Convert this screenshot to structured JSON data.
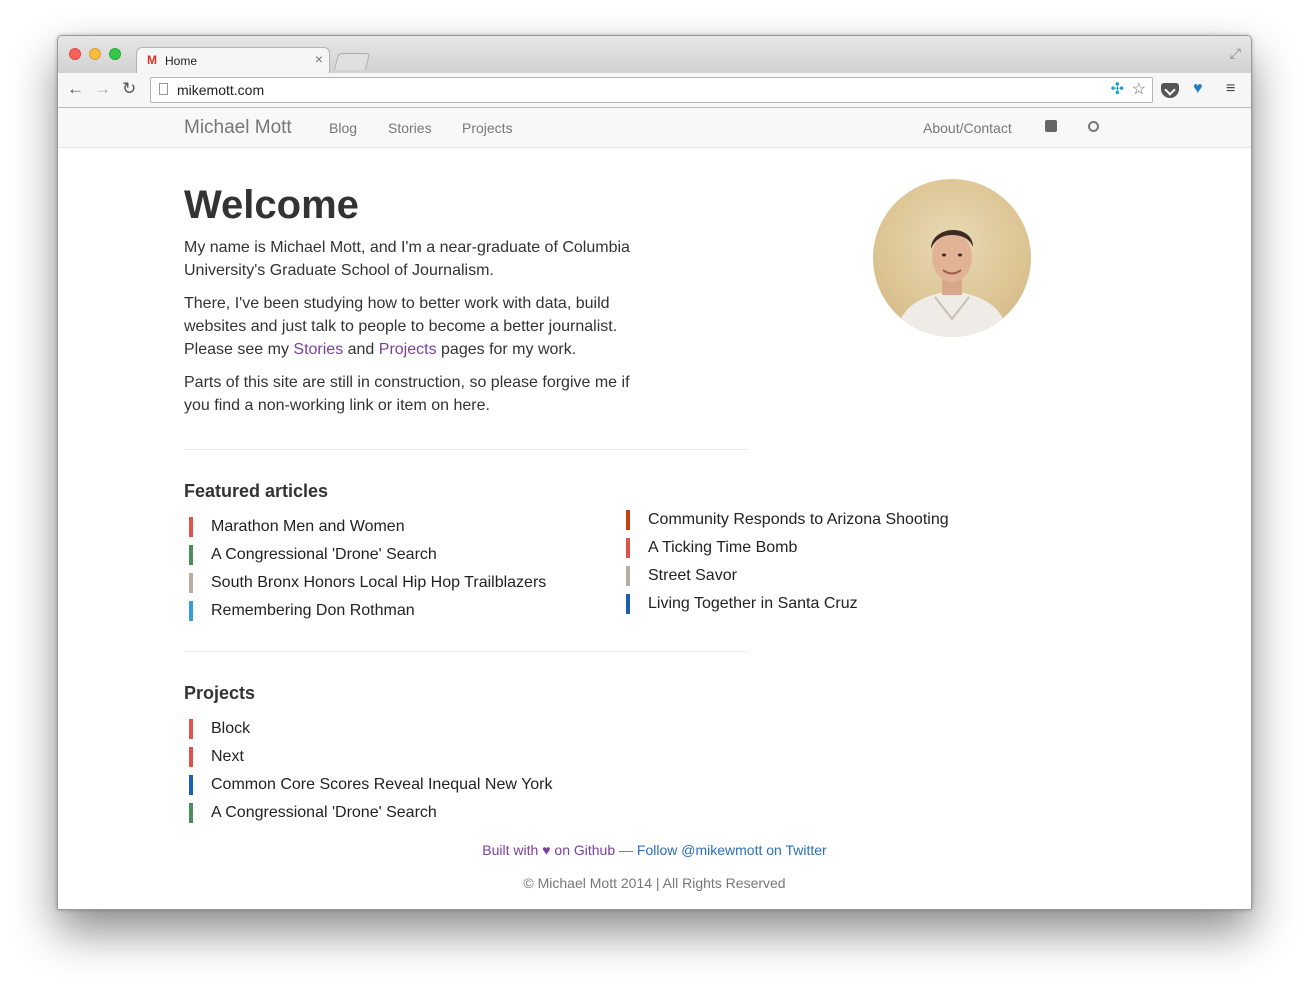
{
  "browser": {
    "tab_title": "Home",
    "tab_favicon": "gmail-icon",
    "url": "mikemott.com"
  },
  "site": {
    "brand": "Michael Mott",
    "nav": {
      "blog": "Blog",
      "stories": "Stories",
      "projects": "Projects",
      "about": "About/Contact"
    },
    "social_icons": [
      "twitter-icon",
      "github-icon"
    ]
  },
  "welcome": {
    "heading": "Welcome",
    "p1": "My name is Michael Mott, and I'm a near-graduate of Columbia University's Graduate School of Journalism.",
    "p2_before": "There, I've been studying how to better work with data, build websites and just talk to people to become a better journalist. Please see my ",
    "p2_link1": "Stories",
    "p2_mid": " and ",
    "p2_link2": "Projects",
    "p2_after": " pages for my work.",
    "p3": "Parts of this site are still in construction, so please forgive me if you find a non-working link or item on here."
  },
  "featured": {
    "heading": "Featured articles",
    "left": [
      {
        "title": "Marathon Men and Women",
        "color": "#e0534a"
      },
      {
        "title": "A Congressional 'Drone' Search",
        "color": "#4a8f5d"
      },
      {
        "title": "South Bronx Honors Local Hip Hop Trailblazers",
        "color": "#b8aea6"
      },
      {
        "title": "Remembering Don Rothman",
        "color": "#3a9bd9"
      }
    ],
    "right": [
      {
        "title": "Community Responds to Arizona Shooting",
        "color": "#c4420f"
      },
      {
        "title": "A Ticking Time Bomb",
        "color": "#e0534a"
      },
      {
        "title": "Street Savor",
        "color": "#b8aea6"
      },
      {
        "title": "Living Together in Santa Cruz",
        "color": "#1b5fb0"
      }
    ]
  },
  "projects": {
    "heading": "Projects",
    "items": [
      {
        "title": "Block",
        "color": "#e0534a"
      },
      {
        "title": "Next",
        "color": "#e0534a"
      },
      {
        "title": "Common Core Scores Reveal Inequal New York",
        "color": "#1b5fb0"
      },
      {
        "title": "A Congressional 'Drone' Search",
        "color": "#4a8f5d"
      }
    ]
  },
  "footer": {
    "built_prefix": "Built with",
    "built_suffix": "on Github",
    "dash": "—",
    "follow": "Follow @mikewmott on Twitter",
    "copyright": "© Michael Mott 2014 | All Rights Reserved"
  }
}
